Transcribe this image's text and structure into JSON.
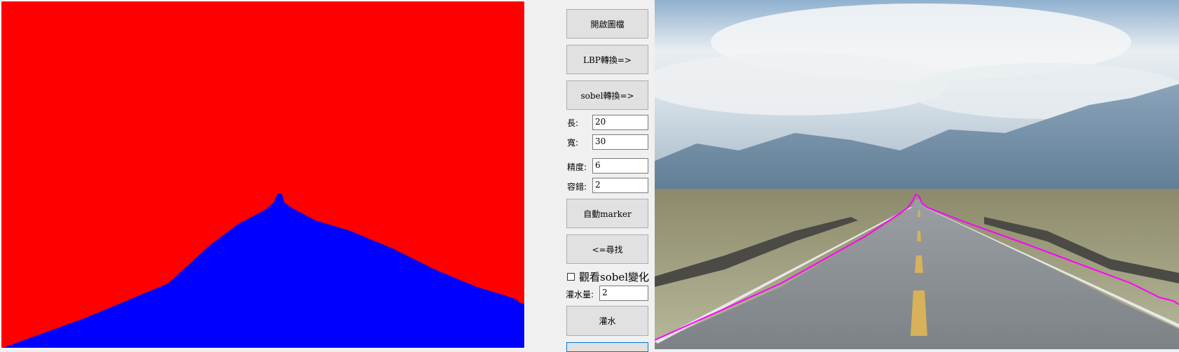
{
  "left_view": {
    "segments": [
      {
        "name": "sky-region",
        "color": "#ff0000"
      },
      {
        "name": "road-region",
        "color": "#0000ff"
      }
    ]
  },
  "controls": {
    "open_image_label": "開啟圖檔",
    "lbp_label": "LBP轉換=>",
    "sobel_label": "sobel轉換=>",
    "length_label": "長:",
    "length_value": "20",
    "width_label": "寬:",
    "width_value": "30",
    "precision_label": "精度:",
    "precision_value": "6",
    "tolerance_label": "容錯:",
    "tolerance_value": "2",
    "auto_marker_label": "自動marker",
    "find_label": "<=尋找",
    "watch_sobel_label": "觀看sobel變化",
    "flood_amount_label": "灌水量:",
    "flood_amount_value": "2",
    "flood_label": "灌水"
  },
  "right_view": {
    "boundary_color": "#ff00ff"
  }
}
